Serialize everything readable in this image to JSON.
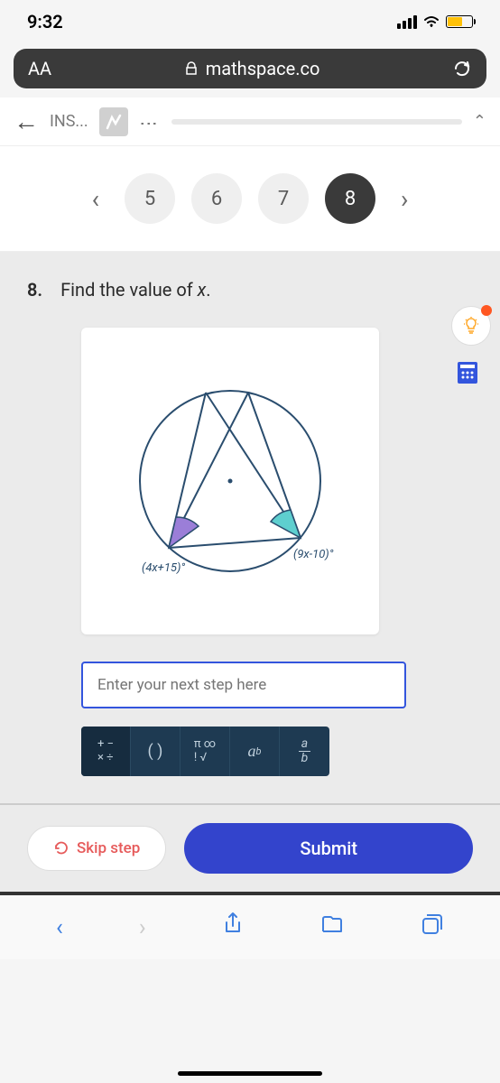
{
  "status_bar": {
    "time": "9:32"
  },
  "address_bar": {
    "aa": "AA",
    "domain": "mathspace.co"
  },
  "app_header": {
    "title": "INS..."
  },
  "nav": {
    "items": [
      "5",
      "6",
      "7",
      "8"
    ],
    "active_index": 3
  },
  "question": {
    "number": "8.",
    "text_part1": "Find the value of ",
    "text_var": "x",
    "text_part2": "."
  },
  "diagram": {
    "left_label": "(4x+15)°",
    "right_label": "(9x-10)°"
  },
  "input": {
    "placeholder": "Enter your next step here"
  },
  "actions": {
    "skip": "Skip step",
    "submit": "Submit"
  }
}
